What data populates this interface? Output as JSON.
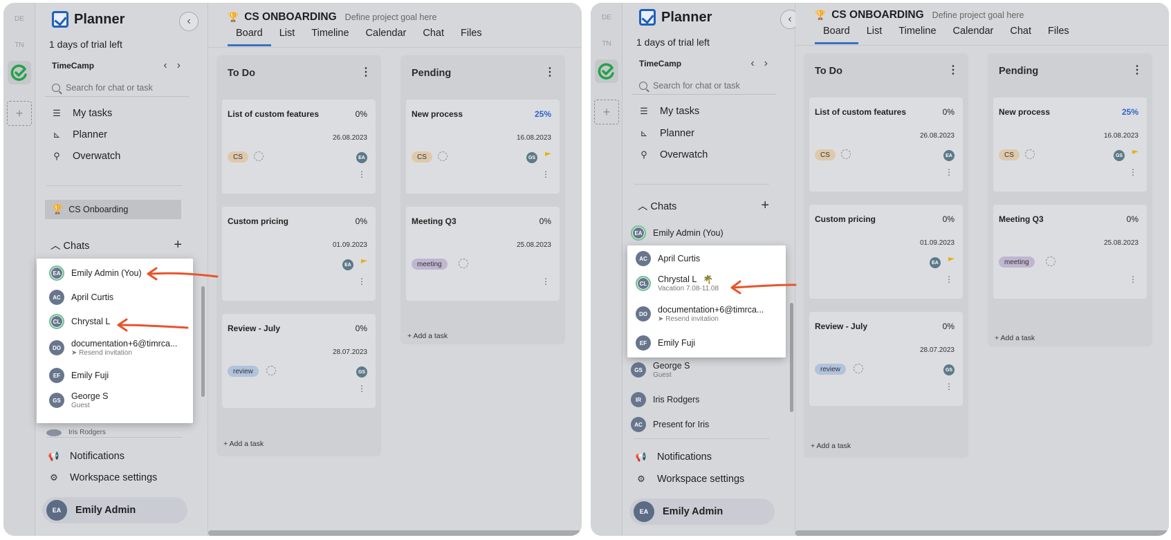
{
  "panels": [
    {
      "rail": {
        "tiles": [
          "DE",
          "TN"
        ],
        "add_label": "+"
      },
      "app_name": "Planner",
      "trial": "1 days of trial left",
      "workspace": "TimeCamp",
      "search_placeholder": "Search for chat or task",
      "nav": [
        "My tasks",
        "Planner",
        "Overwatch"
      ],
      "project_item": "CS Onboarding",
      "chats_label": "Chats",
      "chats": [
        {
          "initials": "EA",
          "name": "Emily Admin (You)",
          "sub": ""
        },
        {
          "initials": "AC",
          "name": "April Curtis",
          "sub": ""
        },
        {
          "initials": "CL",
          "name": "Chrystal L",
          "sub": ""
        },
        {
          "initials": "DO",
          "name": "documentation+6@timrca...",
          "sub": "Resend invitation"
        },
        {
          "initials": "EF",
          "name": "Emily Fuji",
          "sub": ""
        },
        {
          "initials": "GS",
          "name": "George S",
          "sub": "Guest"
        },
        {
          "initials": "IR",
          "name": "Iris Rodgers",
          "sub": ""
        }
      ],
      "footer": [
        "Notifications",
        "Workspace settings"
      ],
      "user": {
        "initials": "EA",
        "name": "Emily Admin"
      }
    },
    {
      "rail": {
        "tiles": [
          "DE",
          "TN"
        ],
        "add_label": "+"
      },
      "app_name": "Planner",
      "trial": "1 days of trial left",
      "workspace": "TimeCamp",
      "search_placeholder": "Search for chat or task",
      "nav": [
        "My tasks",
        "Planner",
        "Overwatch"
      ],
      "chats_label": "Chats",
      "chats": [
        {
          "initials": "EA",
          "name": "Emily Admin (You)",
          "sub": ""
        },
        {
          "initials": "AC",
          "name": "April Curtis",
          "sub": ""
        },
        {
          "initials": "CL",
          "name": "Chrystal L",
          "sub": "Vacation 7.08-11.08"
        },
        {
          "initials": "DO",
          "name": "documentation+6@timrca...",
          "sub": "Resend invitation"
        },
        {
          "initials": "EF",
          "name": "Emily Fuji",
          "sub": ""
        },
        {
          "initials": "GS",
          "name": "George S",
          "sub": "Guest"
        },
        {
          "initials": "IR",
          "name": "Iris Rodgers",
          "sub": ""
        },
        {
          "initials": "AC",
          "name": "Present for Iris",
          "sub": ""
        }
      ],
      "footer": [
        "Notifications",
        "Workspace settings"
      ],
      "user": {
        "initials": "EA",
        "name": "Emily Admin"
      }
    }
  ],
  "project": {
    "title": "CS ONBOARDING",
    "goal": "Define project goal here",
    "tabs": [
      "Board",
      "List",
      "Timeline",
      "Calendar",
      "Chat",
      "Files"
    ]
  },
  "board": {
    "add_task": "Add a task",
    "columns": [
      {
        "name": "To Do",
        "cards": [
          {
            "title": "List of custom features",
            "pct": "0%",
            "date": "26.08.2023",
            "tag": "CS",
            "avatar": "EA",
            "flag": false
          },
          {
            "title": "Custom pricing",
            "pct": "0%",
            "date": "01.09.2023",
            "tag": "",
            "avatar": "EA",
            "flag": true
          },
          {
            "title": "Review - July",
            "pct": "0%",
            "date": "28.07.2023",
            "tag": "review",
            "avatar": "GS",
            "flag": false
          }
        ]
      },
      {
        "name": "Pending",
        "cards": [
          {
            "title": "New process",
            "pct": "25%",
            "date": "16.08.2023",
            "tag": "CS",
            "avatar": "GS",
            "flag": true
          },
          {
            "title": "Meeting Q3",
            "pct": "0%",
            "date": "25.08.2023",
            "tag": "meeting",
            "avatar": "",
            "flag": false
          }
        ]
      }
    ]
  },
  "colors": {
    "accent_blue": "#2e66c6",
    "annotation_arrow": "#e8542a",
    "logo_green": "#22a34a"
  }
}
